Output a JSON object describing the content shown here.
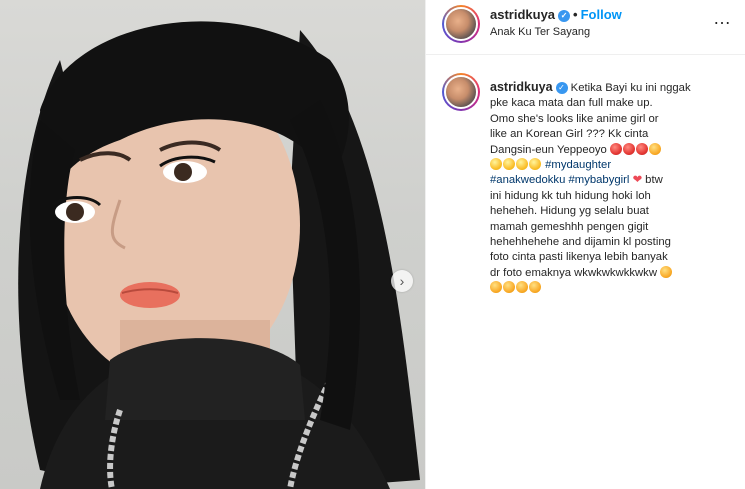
{
  "post": {
    "username": "astridkuya",
    "follow_label": "Follow",
    "location": "Anak Ku Ter Sayang",
    "more_label": "…"
  },
  "caption": {
    "username": "astridkuya",
    "lines": [
      "Ketika Bayi ku ini nggak",
      "pke kaca mata dan full make up.",
      "Omo she's looks like anime girl or",
      "like an Korean Girl ??? Kk cinta",
      "Dangsin-eun Yeppeoyo"
    ],
    "tag_mydaughter": "#mydaughter",
    "tag_anakwedokku": "#anakwedokku",
    "tag_mybabygirl": "#mybabygirl",
    "after_heart": "btw",
    "lines_2": [
      "ini hidung kk tuh hidung hoki loh",
      "heheheh. Hidung yg selalu buat",
      "mamah gemeshhh pengen gigit",
      "hehehhehehe and dijamin kl posting",
      "foto cinta pasti likenya lebih banyak",
      "dr foto emaknya wkwkwkwkkwkw"
    ]
  },
  "colors": {
    "link_blue": "#0095f6",
    "hashtag": "#00376b",
    "verified": "#3897f0",
    "heart": "#ed4956"
  },
  "icons": {
    "verified": "verified-badge-icon",
    "next": "chevron-right-icon",
    "more": "more-options-icon"
  }
}
